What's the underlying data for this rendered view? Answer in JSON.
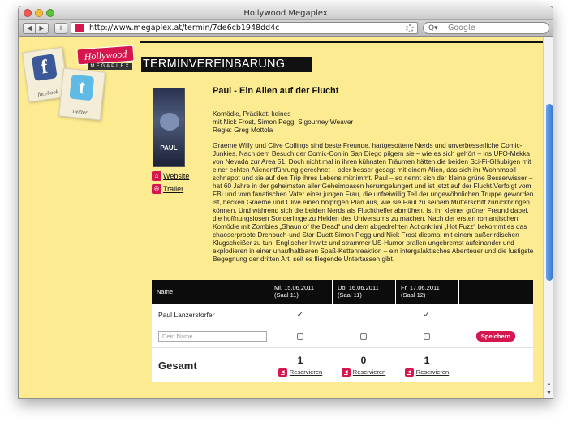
{
  "window": {
    "title": "Hollywood Megaplex",
    "url": "http://www.megaplex.at/termin/7de6cb1948dd4c",
    "search_placeholder": "Google"
  },
  "sidebar": {
    "logo_main": "Hollywood",
    "logo_sub": "MEGAPLEX",
    "facebook_caption": "facebook",
    "twitter_caption": "twitter"
  },
  "page": {
    "heading": "TERMINVEREINBARUNG",
    "poster_title": "PAUL",
    "link_website": "Website",
    "link_trailer": "Trailer",
    "film_title": "Paul - Ein Alien auf der Flucht",
    "meta_genre": "Komödie, Prädikat: keines",
    "meta_cast": "mit Nick Frost, Simon Pegg, Sigourney Weaver",
    "meta_director": "Regie: Greg Mottola",
    "description": "Graeme Willy und Clive Collings sind beste Freunde, hartgesottene Nerds und unverbesserliche Comic-Junkies. Nach dem Besuch der Comic-Con in San Diego pilgern sie – wie es sich gehört – ins UFO-Mekka von Nevada zur Area 51. Doch nicht mal in ihren kühnsten Träumen hätten die beiden Sci-Fi-Gläubigen mit einer echten Alienentführung gerechnet – oder besser gesagt mit einem Alien, das sich ihr Wohnmobil schnappt und sie auf den Trip ihres Lebens mitnimmt. Paul – so nennt sich der kleine grüne Besserwisser – hat 60 Jahre in der geheimsten aller Geheimbasen herumgelungert und ist jetzt auf der Flucht.Verfolgt vom FBI und vom fanatischen Vater einer jungen Frau, die unfreiwillig Teil der ungewöhnlichen Truppe geworden ist, hecken Graeme und Clive einen holprigen Plan aus, wie sie Paul zu seinem Mutterschiff zurückbringen können. Und während sich die beiden Nerds als Fluchthelfer abmühen, ist ihr kleiner grüner Freund dabei, die hoffnungslosen Sonderlinge zu Helden des Universums zu machen. Nach der ersten romantischen Komödie mit Zombies „Shaun of the Dead“ und dem abgedrehten Actionkrimi „Hot Fuzz“ bekommt es das chaoserprobte Drehbuch-und Star-Duett Simon Pegg und Nick Frost diesmal mit einem außerirdischen Klugscheißer zu tun. Englischer Irrwitz und strammer US-Humor prallen ungebremst aufeinander und explodieren in einer unaufhaltbaren Spaß-Kettenreaktion – ein intergalaktisches Abenteuer und die lustigste Begegnung der dritten Art, seit es fliegende Untertassen gibt."
  },
  "table": {
    "header_name": "Name",
    "dates": [
      {
        "date": "Mi, 15.06.2011",
        "hall": "(Saal 11)"
      },
      {
        "date": "Do, 16.06.2011",
        "hall": "(Saal 11)"
      },
      {
        "date": "Fr, 17.06.2011",
        "hall": "(Saal 12)"
      }
    ],
    "participant": "Paul Lanzerstorfer",
    "participant_votes": [
      "✓",
      "",
      "✓"
    ],
    "name_placeholder": "Dein Name",
    "save_label": "Speichern",
    "total_label": "Gesamt",
    "totals": [
      "1",
      "0",
      "1"
    ],
    "reserve_label": "Reservieren"
  },
  "colors": {
    "background": "#fdeb91",
    "accent": "#d6174f",
    "header": "#0c0c0c"
  }
}
